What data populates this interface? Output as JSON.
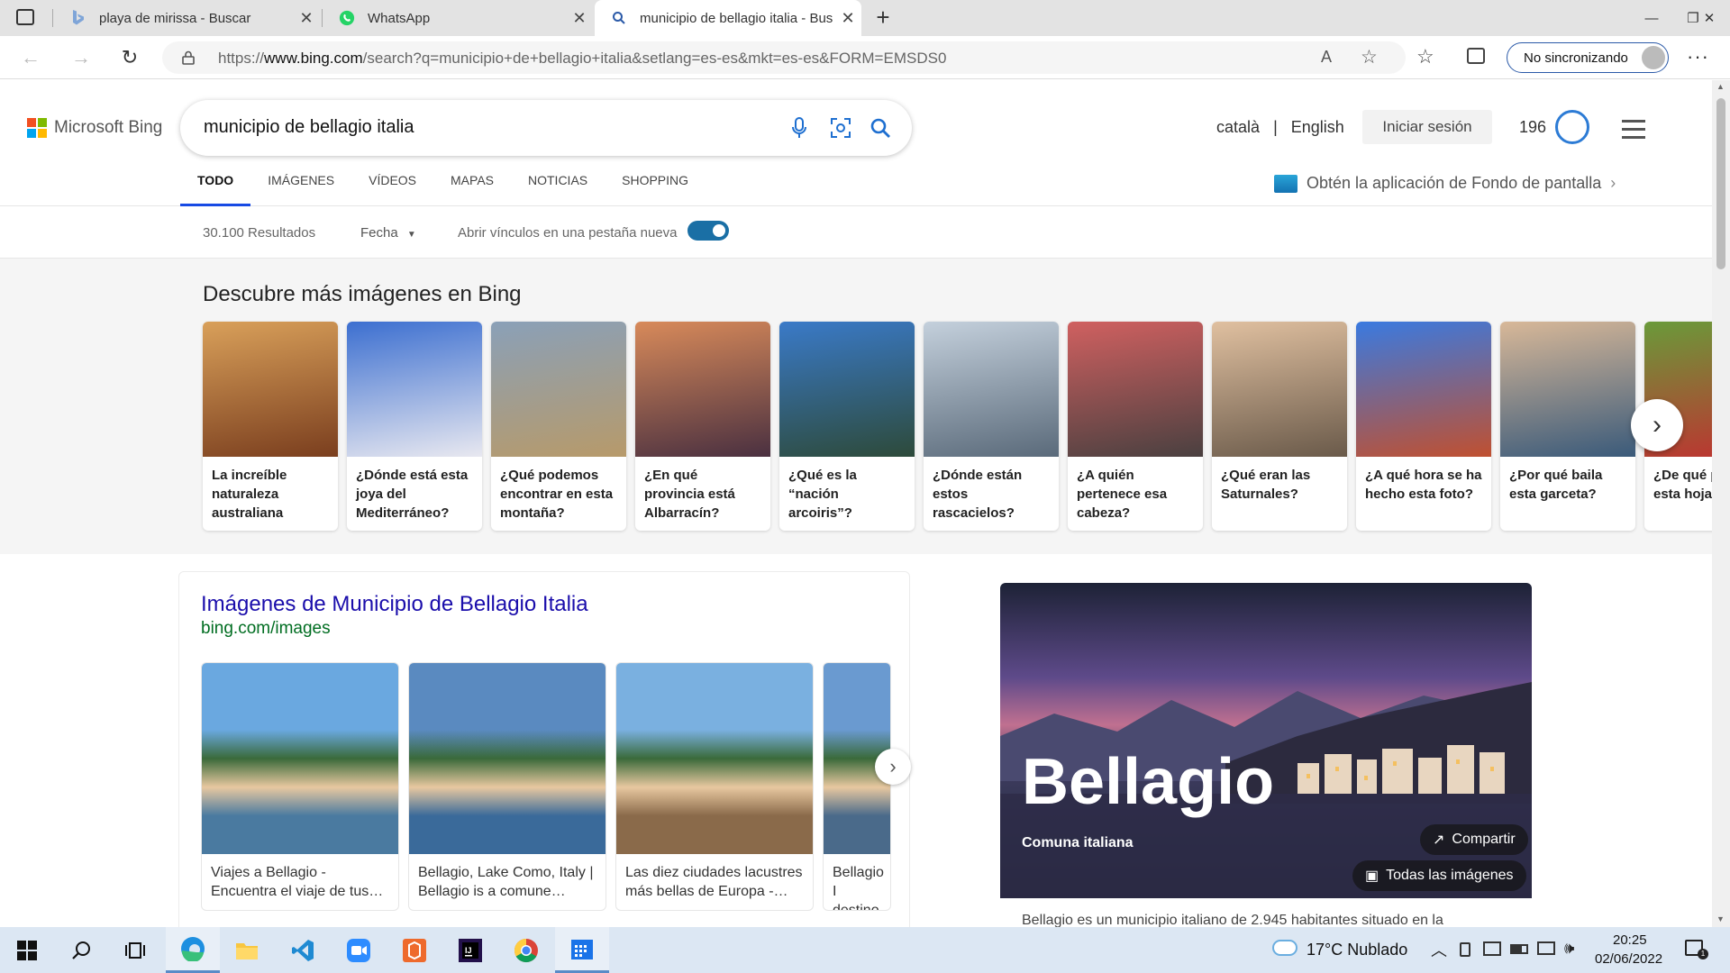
{
  "browser": {
    "tabs": [
      {
        "title": "playa de mirissa - Buscar",
        "favicon": "bing-icon"
      },
      {
        "title": "WhatsApp",
        "favicon": "whatsapp-icon"
      },
      {
        "title": "municipio de bellagio italia - Bus",
        "favicon": "search-icon",
        "active": true
      }
    ],
    "url_prefix": "https://",
    "url_host": "www.bing.com",
    "url_path": "/search?q=municipio+de+bellagio+italia&setlang=es-es&mkt=es-es&FORM=EMSDS0",
    "sync_label": "No sincronizando"
  },
  "bing": {
    "logo": "Microsoft Bing",
    "query": "municipio de bellagio italia",
    "lang_ca": "català",
    "lang_sep": "|",
    "lang_en": "English",
    "signin": "Iniciar sesión",
    "points": "196",
    "scopes": [
      "TODO",
      "IMÁGENES",
      "VÍDEOS",
      "MAPAS",
      "NOTICIAS",
      "SHOPPING"
    ],
    "wallpaper_promo": "Obtén la aplicación de Fondo de pantalla",
    "results_count": "30.100 Resultados",
    "date_filter": "Fecha",
    "new_tab_label": "Abrir vínculos en una pestaña nueva"
  },
  "discover": {
    "title": "Descubre más imágenes en Bing",
    "cards": [
      {
        "caption": "La increíble naturaleza australiana",
        "colors": [
          "#d9a05a",
          "#7a3e1e"
        ]
      },
      {
        "caption": "¿Dónde está esta joya del Mediterráneo?",
        "colors": [
          "#3c6fd0",
          "#e8e8f0"
        ]
      },
      {
        "caption": "¿Qué podemos encontrar en esta montaña?",
        "colors": [
          "#8aa0b8",
          "#b79a6a"
        ]
      },
      {
        "caption": "¿En qué provincia está Albarracín?",
        "colors": [
          "#d88a5a",
          "#4a3040"
        ]
      },
      {
        "caption": "¿Qué es la “nación arcoiris”?",
        "colors": [
          "#3a7ac8",
          "#2d4a3a"
        ]
      },
      {
        "caption": "¿Dónde están estos rascacielos?",
        "colors": [
          "#c4d0dc",
          "#5a6a7a"
        ]
      },
      {
        "caption": "¿A quién pertenece esa cabeza?",
        "colors": [
          "#d06060",
          "#4a4040"
        ]
      },
      {
        "caption": "¿Qué eran las Saturnales?",
        "colors": [
          "#e0c0a0",
          "#6a5a4a"
        ]
      },
      {
        "caption": "¿A qué hora se ha hecho esta foto?",
        "colors": [
          "#3a7ae0",
          "#c05030"
        ]
      },
      {
        "caption": "¿Por qué baila esta garceta?",
        "colors": [
          "#d8b898",
          "#3a5a7a"
        ]
      },
      {
        "caption": "¿De qué planta es esta hoja?",
        "colors": [
          "#6a9a3a",
          "#c03030"
        ]
      }
    ]
  },
  "images_result": {
    "title": "Imágenes de Municipio de Bellagio Italia",
    "url": "bing.com/images",
    "cards": [
      {
        "caption": "Viajes a Bellagio - Encuentra el viaje de tus…",
        "colors": [
          "#6aa8e0",
          "#4a7aa0"
        ]
      },
      {
        "caption": "Bellagio, Lake Como, Italy | Bellagio is a comune…",
        "colors": [
          "#5a8ac0",
          "#3a6a9a"
        ]
      },
      {
        "caption": "Las diez ciudades lacustres más bellas de Europa -…",
        "colors": [
          "#7ab0e0",
          "#8a6a4a"
        ]
      },
      {
        "caption": "Bellagio I destino p",
        "colors": [
          "#6a9ad0",
          "#4a6a8a"
        ]
      }
    ]
  },
  "entity": {
    "name": "Bellagio",
    "subtitle": "Comuna italiana",
    "share": "Compartir",
    "all_images": "Todas las imágenes",
    "description": "Bellagio es un municipio italiano de 2.945 habitantes situado en la"
  },
  "taskbar": {
    "weather": "17°C  Nublado",
    "time": "20:25",
    "date": "02/06/2022"
  }
}
